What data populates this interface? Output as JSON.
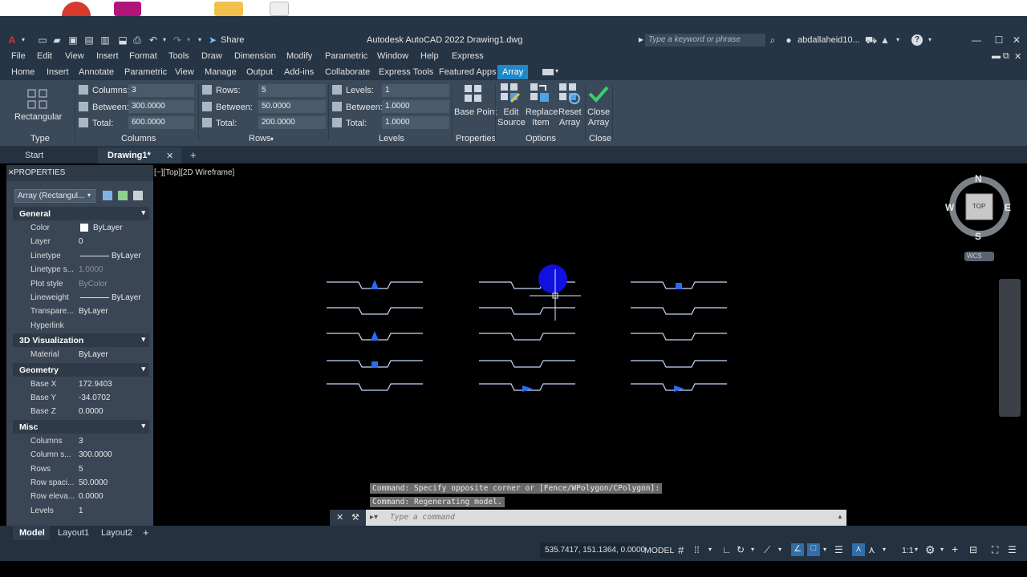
{
  "app": {
    "title": "Autodesk AutoCAD 2022    Drawing1.dwg",
    "share_label": "Share",
    "search_placeholder": "Type a keyword or phrase",
    "user": "abdallaheid10...",
    "app_button": "A"
  },
  "menu": [
    "File",
    "Edit",
    "View",
    "Insert",
    "Format",
    "Tools",
    "Draw",
    "Dimension",
    "Modify",
    "Parametric",
    "Window",
    "Help",
    "Express"
  ],
  "ribbon_tabs": [
    "Home",
    "Insert",
    "Annotate",
    "Parametric",
    "View",
    "Manage",
    "Output",
    "Add-ins",
    "Collaborate",
    "Express Tools",
    "Featured Apps",
    "Array"
  ],
  "ribbon": {
    "type_button": "Rectangular",
    "columns": {
      "count_label": "Columns:",
      "count": "3",
      "between_label": "Between:",
      "between": "300.0000",
      "total_label": "Total:",
      "total": "600.0000"
    },
    "rows": {
      "count_label": "Rows:",
      "count": "5",
      "between_label": "Between:",
      "between": "50.0000",
      "total_label": "Total:",
      "total": "200.0000"
    },
    "levels": {
      "count_label": "Levels:",
      "count": "1",
      "between_label": "Between:",
      "between": "1.0000",
      "total_label": "Total:",
      "total": "1.0000"
    },
    "base_point": "Base Point",
    "edit_source": [
      "Edit",
      "Source"
    ],
    "replace_item": [
      "Replace",
      "Item"
    ],
    "reset_array": [
      "Reset",
      "Array"
    ],
    "close_array": [
      "Close",
      "Array"
    ],
    "panels": [
      "Type",
      "Columns",
      "Rows",
      "Levels",
      "Properties",
      "Options",
      "Close"
    ]
  },
  "doc_tabs": {
    "start": "Start",
    "active": "Drawing1*"
  },
  "properties": {
    "title": "PROPERTIES",
    "selector": "Array (Rectangul...",
    "sections": [
      {
        "name": "General",
        "rows": [
          {
            "k": "Color",
            "v": "ByLayer"
          },
          {
            "k": "Layer",
            "v": "0"
          },
          {
            "k": "Linetype",
            "v": "ByLayer"
          },
          {
            "k": "Linetype s...",
            "v": "1.0000"
          },
          {
            "k": "Plot style",
            "v": "ByColor"
          },
          {
            "k": "Lineweight",
            "v": "ByLayer"
          },
          {
            "k": "Transpare...",
            "v": "ByLayer"
          },
          {
            "k": "Hyperlink",
            "v": ""
          }
        ]
      },
      {
        "name": "3D Visualization",
        "rows": [
          {
            "k": "Material",
            "v": "ByLayer"
          }
        ]
      },
      {
        "name": "Geometry",
        "rows": [
          {
            "k": "Base X",
            "v": "172.9403"
          },
          {
            "k": "Base Y",
            "v": "-34.0702"
          },
          {
            "k": "Base Z",
            "v": "0.0000"
          }
        ]
      },
      {
        "name": "Misc",
        "rows": [
          {
            "k": "Columns",
            "v": "3"
          },
          {
            "k": "Column s...",
            "v": "300.0000"
          },
          {
            "k": "Rows",
            "v": "5"
          },
          {
            "k": "Row spaci...",
            "v": "50.0000"
          },
          {
            "k": "Row eleva...",
            "v": "0.0000"
          },
          {
            "k": "Levels",
            "v": "1"
          }
        ]
      }
    ]
  },
  "viewport": {
    "label": "[−][Top][2D Wireframe]",
    "compass": {
      "n": "N",
      "s": "S",
      "e": "E",
      "w": "W",
      "top": "TOP",
      "ucs": "WCS"
    }
  },
  "command": {
    "history": [
      "Command: Specify opposite corner or [Fence/WPolygon/CPolygon]:",
      "Command: Regenerating model."
    ],
    "placeholder": "Type a command"
  },
  "layout_tabs": [
    "Model",
    "Layout1",
    "Layout2"
  ],
  "status": {
    "coords": "535.7417, 151.1364, 0.0000",
    "model": "MODEL",
    "scale": "1:1"
  },
  "colors": {
    "accent": "#1e88c8",
    "shape_line": "#c8d8ff",
    "shape_fill": "#2a6cf0",
    "grip": "#1010e0",
    "check": "#3ccf6a"
  },
  "array_marker_kinds": [
    [
      "triangle-up",
      "none",
      "triangle-up",
      "square",
      "none"
    ],
    [
      "none",
      "none",
      "none",
      "none",
      "triangle-right"
    ],
    [
      "square",
      "none",
      "none",
      "none",
      "triangle-right"
    ]
  ]
}
